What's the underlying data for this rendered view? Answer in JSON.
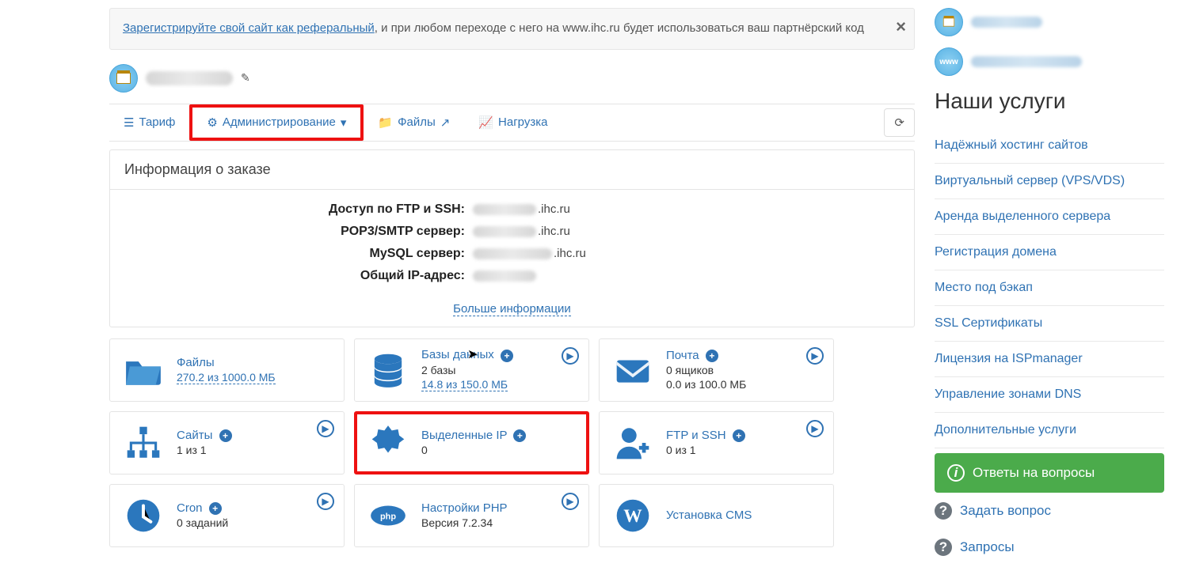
{
  "alert": {
    "link": "Зарегистрируйте свой сайт как реферальный",
    "text_after": ", и при любом переходе с него на www.ihc.ru будет использоваться ваш партнёрский код"
  },
  "toolbar": {
    "tariff": "Тариф",
    "admin": "Администрирование",
    "files": "Файлы",
    "load": "Нагрузка"
  },
  "info_panel": {
    "title": "Информация о заказе",
    "rows": {
      "ftp_label": "Доступ по FTP и SSH:",
      "ftp_suffix": ".ihc.ru",
      "pop_label": "POP3/SMTP сервер:",
      "pop_suffix": ".ihc.ru",
      "mysql_label": "MySQL сервер:",
      "mysql_suffix": ".ihc.ru",
      "ip_label": "Общий IP-адрес:"
    },
    "more": "Больше информации"
  },
  "cards": {
    "files": {
      "title": "Файлы",
      "sub": "270.2 из 1000.0 МБ"
    },
    "db": {
      "title": "Базы данных",
      "sub": "2 базы",
      "extra": "14.8 из 150.0 МБ"
    },
    "mail": {
      "title": "Почта",
      "sub": "0 ящиков",
      "extra": "0.0 из 100.0 МБ"
    },
    "sites": {
      "title": "Сайты",
      "sub": "1 из 1"
    },
    "ip": {
      "title": "Выделенные IP",
      "sub": "0"
    },
    "ftp": {
      "title": "FTP и SSH",
      "sub": "0 из 1"
    },
    "cron": {
      "title": "Cron",
      "sub": "0 заданий"
    },
    "php": {
      "title": "Настройки PHP",
      "sub": "Версия 7.2.34"
    },
    "cms": {
      "title": "Установка CMS"
    }
  },
  "sidebar": {
    "title": "Наши услуги",
    "links": [
      "Надёжный хостинг сайтов",
      "Виртуальный сервер (VPS/VDS)",
      "Аренда выделенного сервера",
      "Регистрация домена",
      "Место под бэкап",
      "SSL Сертификаты",
      "Лицензия на ISPmanager",
      "Управление зонами DNS",
      "Дополнительные услуги"
    ],
    "answers_btn": "Ответы на вопросы",
    "ask": "Задать вопрос",
    "requests": "Запросы"
  }
}
